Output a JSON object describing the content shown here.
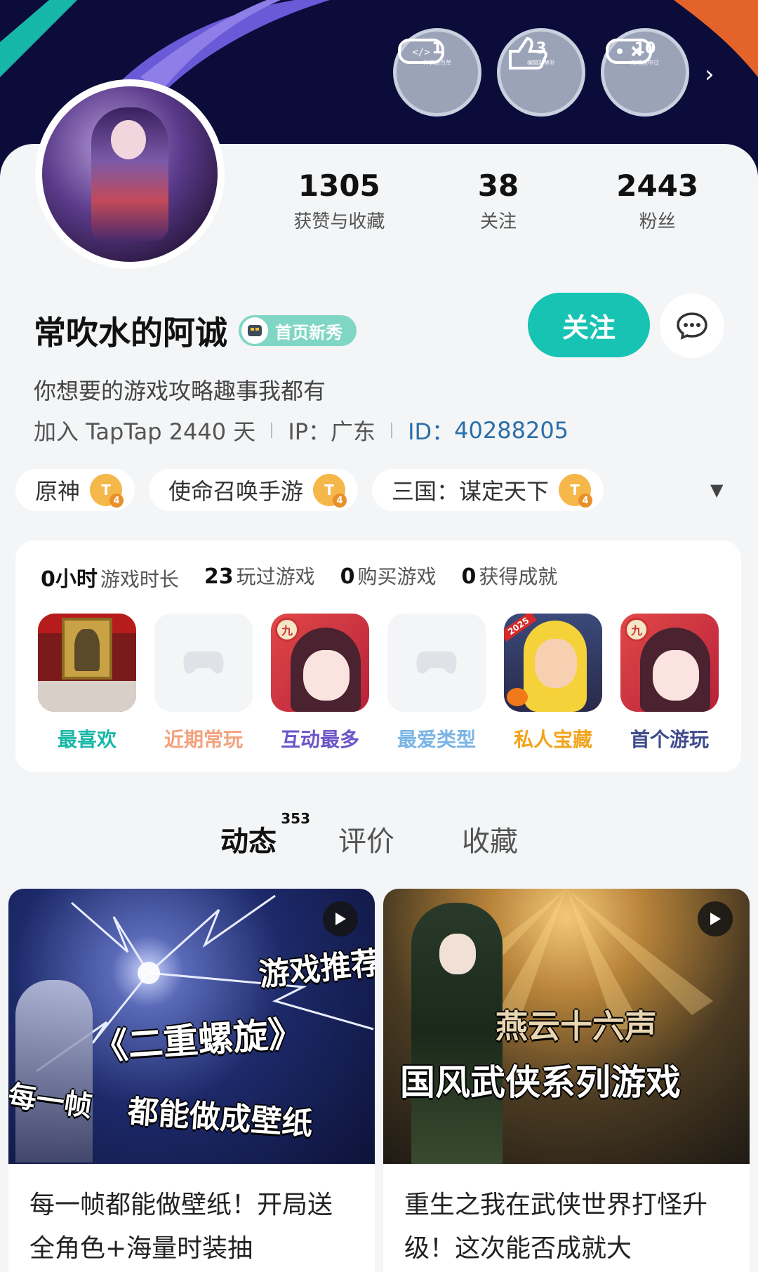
{
  "header": {
    "badges": [
      {
        "num": "1",
        "label": "神农尝百草"
      },
      {
        "num": "3",
        "label": "编辑部替补"
      },
      {
        "num": "10",
        "label": "万花丛中过"
      }
    ]
  },
  "profile": {
    "name": "常吹水的阿诚",
    "tag": "首页新秀",
    "follow_label": "关注",
    "bio": "你想要的游戏攻略趣事我都有",
    "joined": "加入 TapTap 2440 天",
    "ip": "IP：广东",
    "id_label": "ID：",
    "id_value": "40288205",
    "stats": [
      {
        "value": "1305",
        "label": "获赞与收藏"
      },
      {
        "value": "38",
        "label": "关注"
      },
      {
        "value": "2443",
        "label": "粉丝"
      }
    ]
  },
  "game_chips": [
    {
      "name": "原神",
      "level": "T",
      "sub": "4"
    },
    {
      "name": "使命召唤手游",
      "level": "T",
      "sub": "4"
    },
    {
      "name": "三国：谋定天下",
      "level": "T",
      "sub": "4"
    }
  ],
  "summary": [
    {
      "value": "0小时",
      "label": "游戏时长"
    },
    {
      "value": "23",
      "label": "玩过游戏"
    },
    {
      "value": "0",
      "label": "购买游戏"
    },
    {
      "value": "0",
      "label": "获得成就"
    }
  ],
  "tiles": [
    {
      "label": "最喜欢",
      "color": "#19b8a8"
    },
    {
      "label": "近期常玩",
      "color": "#f3a27e"
    },
    {
      "label": "互动最多",
      "color": "#6b55c8"
    },
    {
      "label": "最爱类型",
      "color": "#7ab4e6"
    },
    {
      "label": "私人宝藏",
      "color": "#f2a41e"
    },
    {
      "label": "首个游玩",
      "color": "#3f4b8c"
    }
  ],
  "tile_marks": {
    "anime_seal": "九",
    "year": "2025"
  },
  "tabs": [
    {
      "label": "动态",
      "count": "353"
    },
    {
      "label": "评价"
    },
    {
      "label": "收藏"
    }
  ],
  "posts": [
    {
      "overlay": [
        "游戏推荐",
        "《二重螺旋》",
        "每一帧",
        "都能做成壁纸"
      ],
      "title": "每一帧都能做壁纸！开局送全角色+海量时装抽"
    },
    {
      "overlay": [
        "国风武侠系列游戏",
        "燕云十六声"
      ],
      "title": "重生之我在武侠世界打怪升级！这次能否成就大"
    }
  ],
  "colors": {
    "accent": "#17c3b2",
    "banner_bg": "#0b0c3a"
  }
}
